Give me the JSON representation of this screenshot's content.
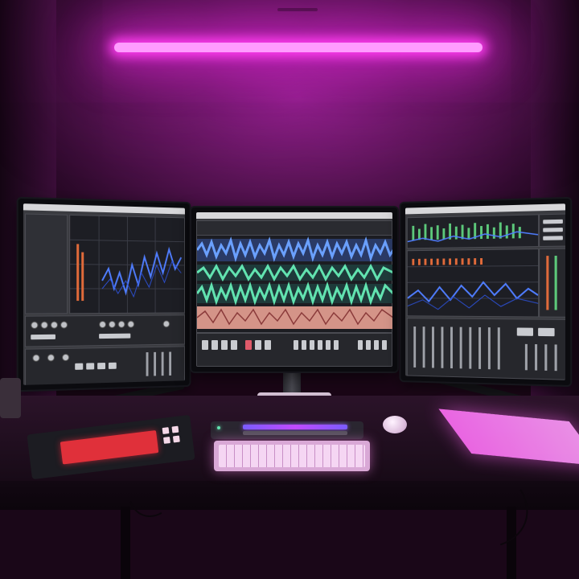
{
  "scene": {
    "description_tags": [
      "studio-desk",
      "triple-monitor",
      "daw-software",
      "neon-light"
    ],
    "colors": {
      "light_bar": "#ff9cff",
      "wall": "#5c1558",
      "waveform_blue": "#6aa0ff",
      "waveform_green": "#62e3b0",
      "waveform_salmon": "#f4a99a",
      "keyboard_red": "#e0303a",
      "keyboard_pink": "#f2c9f2"
    }
  }
}
